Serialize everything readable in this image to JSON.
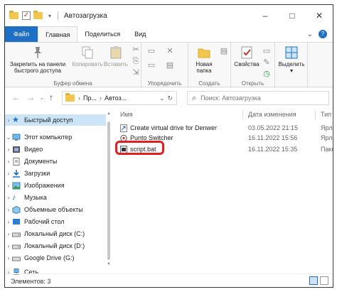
{
  "window": {
    "title": "Автозагрузка"
  },
  "tabs": [
    "Файл",
    "Главная",
    "Поделиться",
    "Вид"
  ],
  "ribbon": {
    "pin_label": "Закрепить на панели быстрого доступа",
    "copy_label": "Копировать",
    "paste_label": "Вставить",
    "clipboard_group": "Буфер обмена",
    "organize_group": "Упорядочить",
    "new_folder_label": "Новая папка",
    "create_group": "Создать",
    "properties_label": "Свойства",
    "open_group": "Открыть",
    "select_label": "Выделить"
  },
  "address": {
    "crumb1": "Пр...",
    "crumb2": "Автоз...",
    "search_placeholder": "Поиск: Автозагрузка"
  },
  "nav": {
    "quick_access": "Быстрый доступ",
    "this_pc": "Этот компьютер",
    "items": [
      "Видео",
      "Документы",
      "Загрузки",
      "Изображения",
      "Музыка",
      "Объемные объекты",
      "Рабочий стол",
      "Локальный диск (C:)",
      "Локальный диск (D:)",
      "Google Drive (G:)"
    ],
    "network": "Сеть"
  },
  "columns": {
    "name": "Имя",
    "date": "Дата изменения",
    "type": "Тип"
  },
  "files": [
    {
      "name": "Create virtual drive for Denwer",
      "date": "03.05.2022 21:15",
      "type": "Ярлык"
    },
    {
      "name": "Punto Switcher",
      "date": "16.11.2022 15:56",
      "type": "Ярлык"
    },
    {
      "name": "script.bat",
      "date": "16.11.2022 15:35",
      "type": "Пакет"
    }
  ],
  "status": {
    "count": "Элементов: 3"
  },
  "colors": {
    "accent": "#1f6fc5",
    "highlight": "#e02020",
    "selection": "#cce4f7",
    "folder": "#f3c74d"
  }
}
